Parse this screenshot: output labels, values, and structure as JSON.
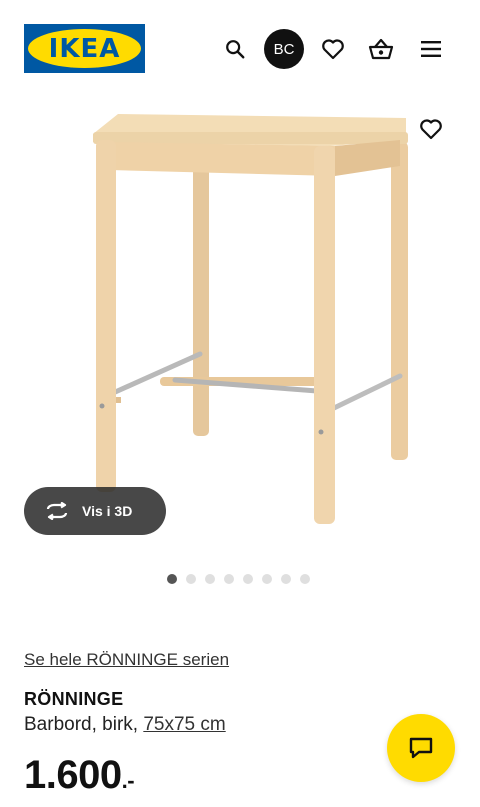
{
  "header": {
    "logo_text": "IKEA",
    "avatar_initials": "BC",
    "icons": [
      "search-icon",
      "heart-icon",
      "basket-icon",
      "menu-icon"
    ]
  },
  "gallery": {
    "view_3d_label": "Vis i 3D",
    "dot_count": 8,
    "active_index": 0
  },
  "product": {
    "series_link": "Se hele RÖNNINGE serien",
    "name": "RÖNNINGE",
    "description_prefix": "Barbord, birk, ",
    "size_link": "75x75 cm",
    "price": "1.600",
    "price_suffix": ".-"
  },
  "colors": {
    "brand_blue": "#0058a3",
    "brand_yellow": "#ffdb00",
    "wood": "#efd3aa"
  }
}
